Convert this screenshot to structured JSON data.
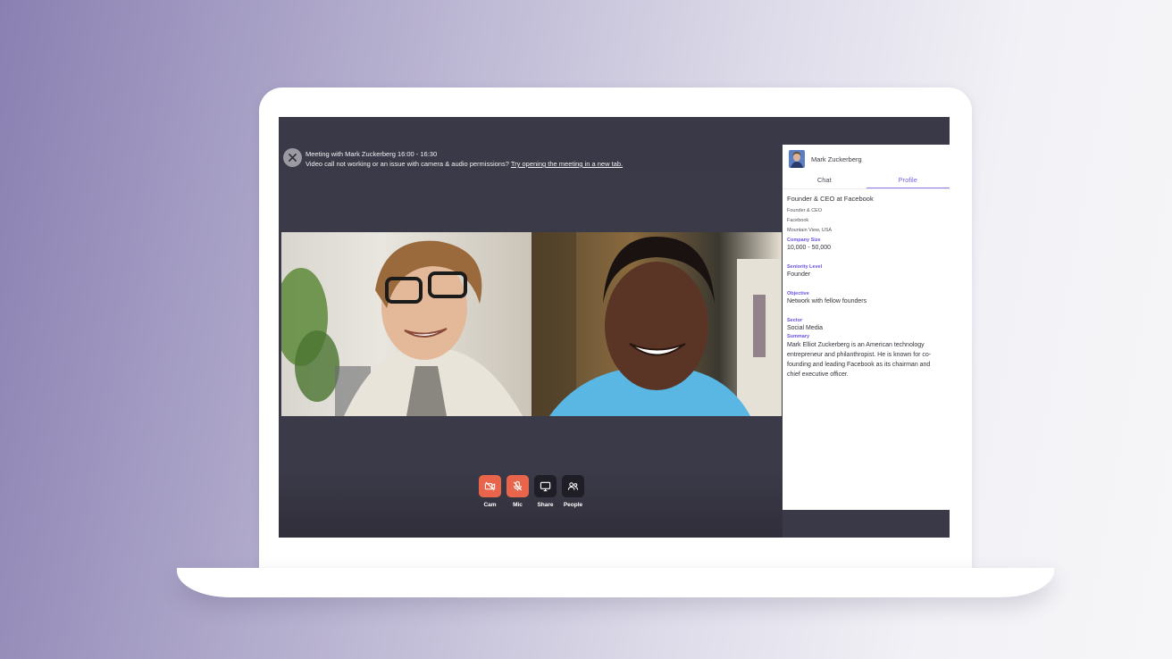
{
  "meeting": {
    "title": "Meeting with Mark Zuckerberg 16:00 - 16:30",
    "notice": "Video call not working or an issue with camera & audio permissions?",
    "notice_link": "Try opening the meeting in a new tab."
  },
  "controls": [
    {
      "label": "Cam",
      "icon": "camera-off-icon",
      "state": "off"
    },
    {
      "label": "Mic",
      "icon": "mic-off-icon",
      "state": "off"
    },
    {
      "label": "Share",
      "icon": "monitor-icon",
      "state": "on"
    },
    {
      "label": "People",
      "icon": "people-icon",
      "state": "on"
    }
  ],
  "sidebar": {
    "user_name": "Mark Zuckerberg",
    "tabs": [
      {
        "label": "Chat",
        "active": false
      },
      {
        "label": "Profile",
        "active": true
      }
    ],
    "profile": {
      "headline": "Founder & CEO at Facebook",
      "role": "Founder & CEO",
      "company": "Facebook",
      "location": "Mountain View, USA",
      "company_size_label": "Company Size",
      "company_size": "10,000 - 50,000",
      "seniority_label": "Seniority Level",
      "seniority": "Founder",
      "objective_label": "Objective",
      "objective": "Network with fellow founders",
      "sector_label": "Sector",
      "sector": "Social Media",
      "summary_label": "Summary",
      "summary": "Mark Elliot Zuckerberg is an American technology entrepreneur and philanthropist. He is known for co-founding and leading Facebook as its chairman and chief executive officer."
    }
  },
  "colors": {
    "accent": "#7a63e6",
    "control_off": "#e8654c",
    "control_on": "#1f1e26",
    "screen_bg": "#3a3947"
  }
}
